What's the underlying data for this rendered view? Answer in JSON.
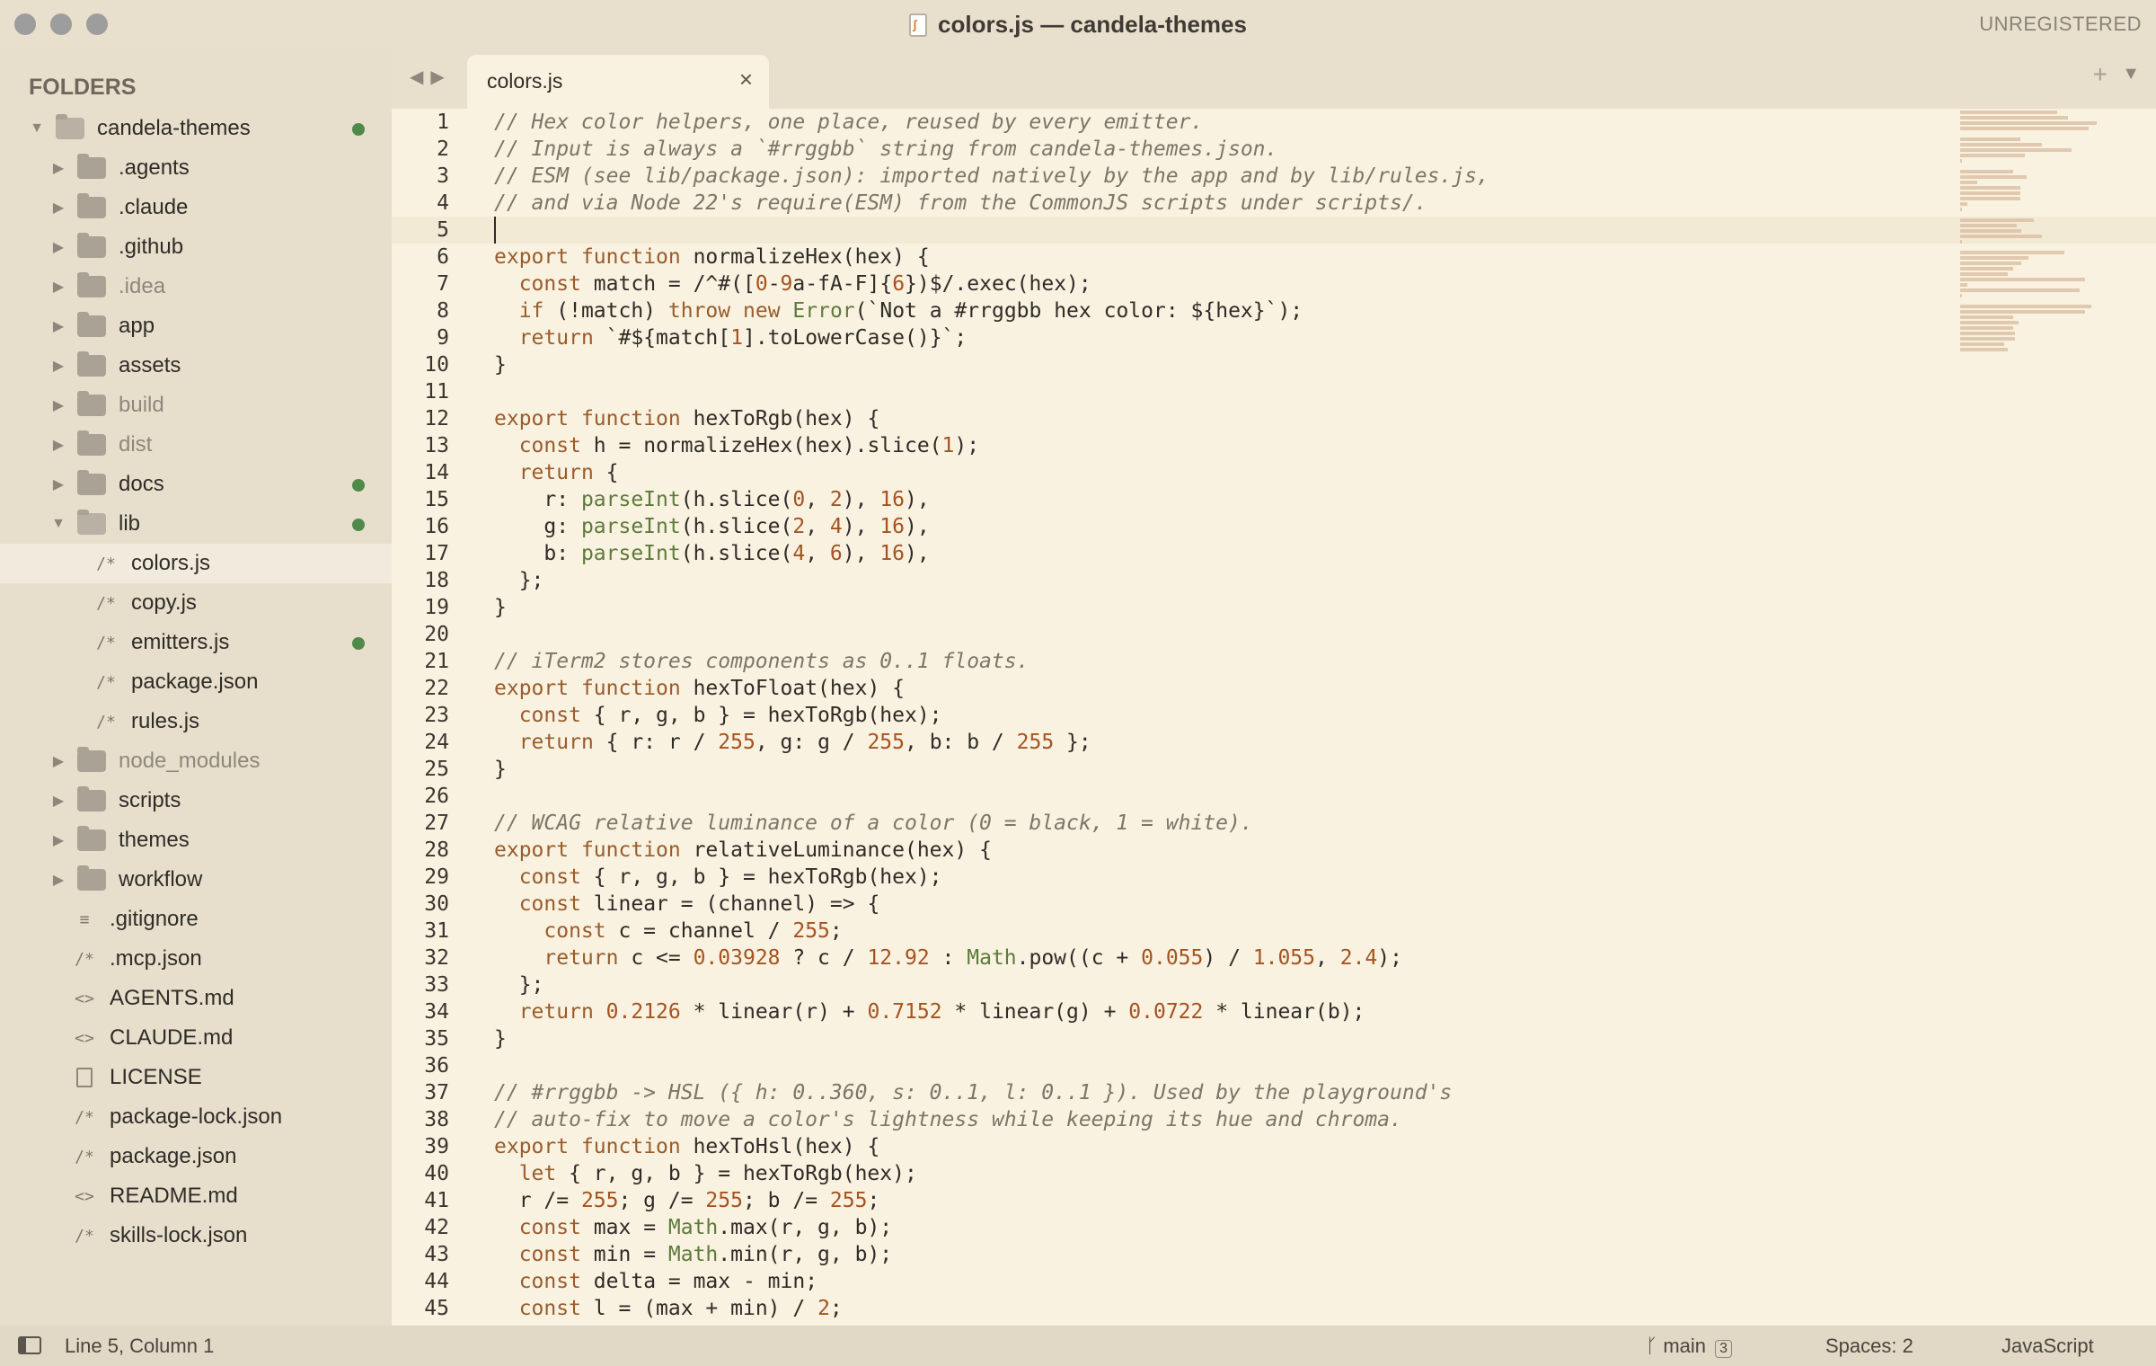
{
  "window": {
    "title": "colors.js — candela-themes",
    "license_status": "UNREGISTERED"
  },
  "sidebar": {
    "header": "FOLDERS",
    "items": [
      {
        "label": "candela-themes",
        "kind": "folder-open",
        "depth": 0,
        "modified": true
      },
      {
        "label": ".agents",
        "kind": "folder",
        "depth": 1,
        "modified": false
      },
      {
        "label": ".claude",
        "kind": "folder",
        "depth": 1,
        "modified": false
      },
      {
        "label": ".github",
        "kind": "folder",
        "depth": 1,
        "modified": false
      },
      {
        "label": ".idea",
        "kind": "folder",
        "depth": 1,
        "modified": false,
        "dim": true
      },
      {
        "label": "app",
        "kind": "folder",
        "depth": 1,
        "modified": false
      },
      {
        "label": "assets",
        "kind": "folder",
        "depth": 1,
        "modified": false
      },
      {
        "label": "build",
        "kind": "folder",
        "depth": 1,
        "modified": false,
        "dim": true
      },
      {
        "label": "dist",
        "kind": "folder",
        "depth": 1,
        "modified": false,
        "dim": true
      },
      {
        "label": "docs",
        "kind": "folder",
        "depth": 1,
        "modified": true
      },
      {
        "label": "lib",
        "kind": "folder-open",
        "depth": 1,
        "modified": true
      },
      {
        "label": "colors.js",
        "kind": "file",
        "icon": "/*",
        "depth": 2,
        "modified": false,
        "selected": true
      },
      {
        "label": "copy.js",
        "kind": "file",
        "icon": "/*",
        "depth": 2,
        "modified": false
      },
      {
        "label": "emitters.js",
        "kind": "file",
        "icon": "/*",
        "depth": 2,
        "modified": true
      },
      {
        "label": "package.json",
        "kind": "file",
        "icon": "/*",
        "depth": 2,
        "modified": false
      },
      {
        "label": "rules.js",
        "kind": "file",
        "icon": "/*",
        "depth": 2,
        "modified": false
      },
      {
        "label": "node_modules",
        "kind": "folder",
        "depth": 1,
        "modified": false,
        "dim": true
      },
      {
        "label": "scripts",
        "kind": "folder",
        "depth": 1,
        "modified": false
      },
      {
        "label": "themes",
        "kind": "folder",
        "depth": 1,
        "modified": false
      },
      {
        "label": "workflow",
        "kind": "folder",
        "depth": 1,
        "modified": false
      },
      {
        "label": ".gitignore",
        "kind": "file",
        "icon": "≡",
        "depth": 1,
        "modified": false
      },
      {
        "label": ".mcp.json",
        "kind": "file",
        "icon": "/*",
        "depth": 1,
        "modified": false
      },
      {
        "label": "AGENTS.md",
        "kind": "file",
        "icon": "<>",
        "depth": 1,
        "modified": false
      },
      {
        "label": "CLAUDE.md",
        "kind": "file",
        "icon": "<>",
        "depth": 1,
        "modified": false
      },
      {
        "label": "LICENSE",
        "kind": "file",
        "icon": "doc",
        "depth": 1,
        "modified": false
      },
      {
        "label": "package-lock.json",
        "kind": "file",
        "icon": "/*",
        "depth": 1,
        "modified": false
      },
      {
        "label": "package.json",
        "kind": "file",
        "icon": "/*",
        "depth": 1,
        "modified": false
      },
      {
        "label": "README.md",
        "kind": "file",
        "icon": "<>",
        "depth": 1,
        "modified": false
      },
      {
        "label": "skills-lock.json",
        "kind": "file",
        "icon": "/*",
        "depth": 1,
        "modified": false
      }
    ]
  },
  "tabs": [
    {
      "label": "colors.js",
      "active": true
    }
  ],
  "editor": {
    "active_line": 5,
    "lines": [
      "// Hex color helpers, one place, reused by every emitter.",
      "// Input is always a `#rrggbb` string from candela-themes.json.",
      "// ESM (see lib/package.json): imported natively by the app and by lib/rules.js,",
      "// and via Node 22's require(ESM) from the CommonJS scripts under scripts/.",
      "",
      "export function normalizeHex(hex) {",
      "  const match = /^#([0-9a-fA-F]{6})$/.exec(hex);",
      "  if (!match) throw new Error(`Not a #rrggbb hex color: ${hex}`);",
      "  return `#${match[1].toLowerCase()}`;",
      "}",
      "",
      "export function hexToRgb(hex) {",
      "  const h = normalizeHex(hex).slice(1);",
      "  return {",
      "    r: parseInt(h.slice(0, 2), 16),",
      "    g: parseInt(h.slice(2, 4), 16),",
      "    b: parseInt(h.slice(4, 6), 16),",
      "  };",
      "}",
      "",
      "// iTerm2 stores components as 0..1 floats.",
      "export function hexToFloat(hex) {",
      "  const { r, g, b } = hexToRgb(hex);",
      "  return { r: r / 255, g: g / 255, b: b / 255 };",
      "}",
      "",
      "// WCAG relative luminance of a color (0 = black, 1 = white).",
      "export function relativeLuminance(hex) {",
      "  const { r, g, b } = hexToRgb(hex);",
      "  const linear = (channel) => {",
      "    const c = channel / 255;",
      "    return c <= 0.03928 ? c / 12.92 : Math.pow((c + 0.055) / 1.055, 2.4);",
      "  };",
      "  return 0.2126 * linear(r) + 0.7152 * linear(g) + 0.0722 * linear(b);",
      "}",
      "",
      "// #rrggbb -> HSL ({ h: 0..360, s: 0..1, l: 0..1 }). Used by the playground's",
      "// auto-fix to move a color's lightness while keeping its hue and chroma.",
      "export function hexToHsl(hex) {",
      "  let { r, g, b } = hexToRgb(hex);",
      "  r /= 255; g /= 255; b /= 255;",
      "  const max = Math.max(r, g, b);",
      "  const min = Math.min(r, g, b);",
      "  const delta = max - min;",
      "  const l = (max + min) / 2;"
    ]
  },
  "statusbar": {
    "position": "Line 5, Column 1",
    "branch": "main",
    "branch_count": "3",
    "indent": "Spaces: 2",
    "syntax": "JavaScript"
  },
  "colors": {
    "background": "#f9f2e1",
    "sidebar": "#e7dfcc",
    "modified_dot": "#4f8a4b",
    "keyword": "#995c2b",
    "comment": "#7d7568"
  }
}
